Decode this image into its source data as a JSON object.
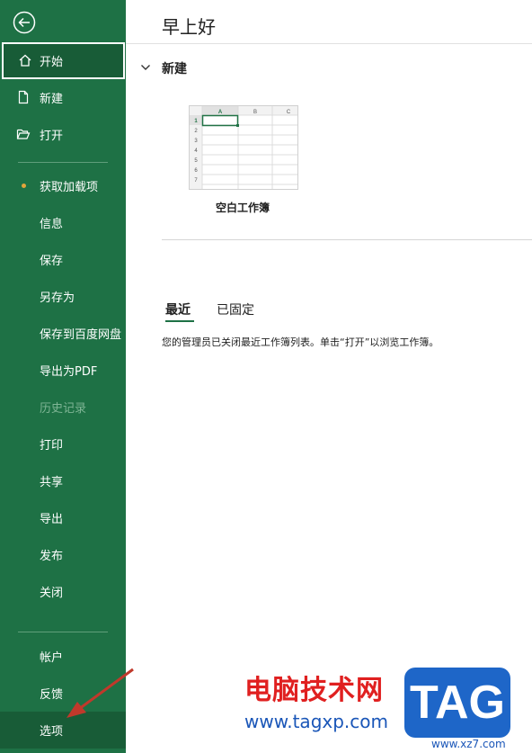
{
  "sidebar": {
    "items": [
      {
        "label": "开始"
      },
      {
        "label": "新建"
      },
      {
        "label": "打开"
      },
      {
        "label": "获取加载项"
      },
      {
        "label": "信息"
      },
      {
        "label": "保存"
      },
      {
        "label": "另存为"
      },
      {
        "label": "保存到百度网盘"
      },
      {
        "label": "导出为PDF"
      },
      {
        "label": "历史记录"
      },
      {
        "label": "打印"
      },
      {
        "label": "共享"
      },
      {
        "label": "导出"
      },
      {
        "label": "发布"
      },
      {
        "label": "关闭"
      },
      {
        "label": "帐户"
      },
      {
        "label": "反馈"
      },
      {
        "label": "选项"
      }
    ]
  },
  "main": {
    "greeting": "早上好",
    "new_section": "新建",
    "blank_workbook": "空白工作簿",
    "sheet_preview": {
      "columns": [
        "A",
        "B",
        "C"
      ],
      "rows": [
        "1",
        "2",
        "3",
        "4",
        "5",
        "6",
        "7"
      ]
    },
    "tabs": [
      {
        "label": "最近"
      },
      {
        "label": "已固定"
      }
    ],
    "recent_message": "您的管理员已关闭最近工作簿列表。单击“打开”以浏览工作簿。"
  },
  "watermark": {
    "site_cn": "电脑技术网",
    "url": "www.tagxp.com",
    "logo": "TAG",
    "secondary": "www.xz7.com"
  },
  "colors": {
    "sidebar": "#1e7145",
    "accent_dot": "#e3a53b",
    "arrow": "#c0392b"
  }
}
